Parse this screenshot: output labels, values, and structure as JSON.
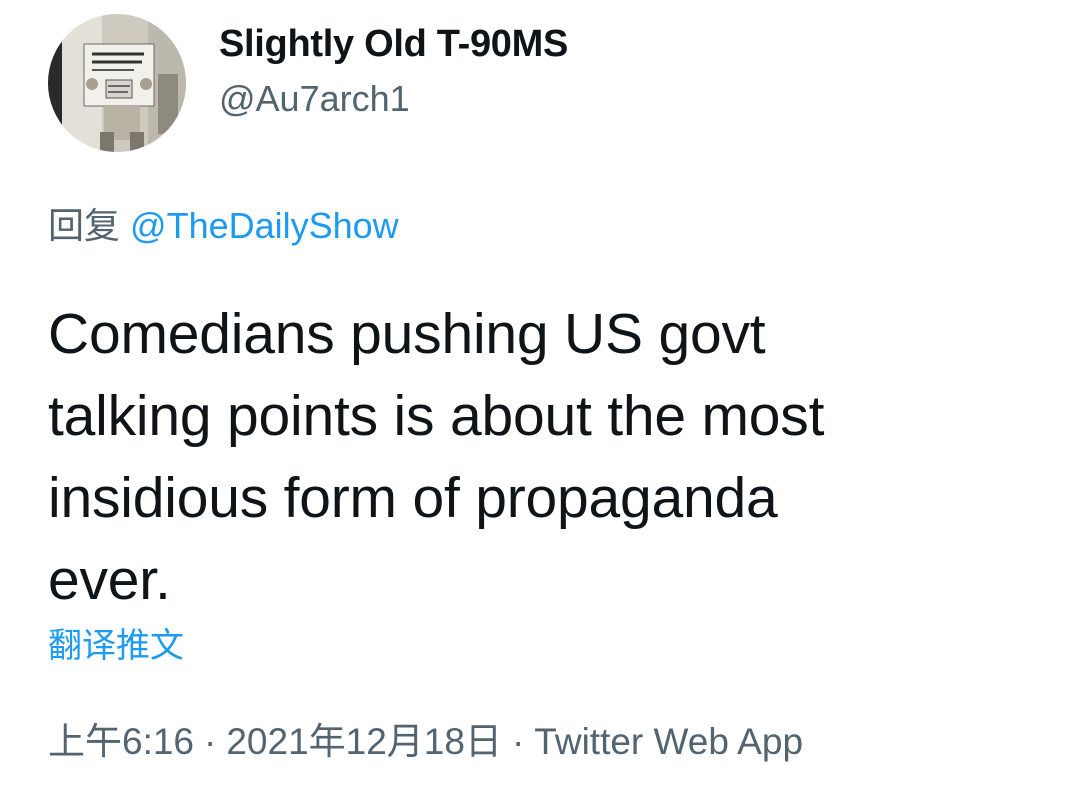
{
  "author": {
    "display_name": "Slightly Old T-90MS",
    "handle": "@Au7arch1"
  },
  "reply": {
    "prefix": "回复",
    "mention": "@TheDailyShow"
  },
  "tweet": {
    "line1": "Comedians pushing US govt",
    "line2": "talking points is about the most",
    "line3": "insidious form of propaganda",
    "line4": "ever."
  },
  "translate_label": "翻译推文",
  "meta": {
    "time": "上午6:16",
    "separator": "·",
    "date": "2021年12月18日",
    "source": "Twitter Web App"
  },
  "colors": {
    "link": "#1d9bf0",
    "secondary_text": "#536471",
    "primary_text": "#0f1419"
  }
}
